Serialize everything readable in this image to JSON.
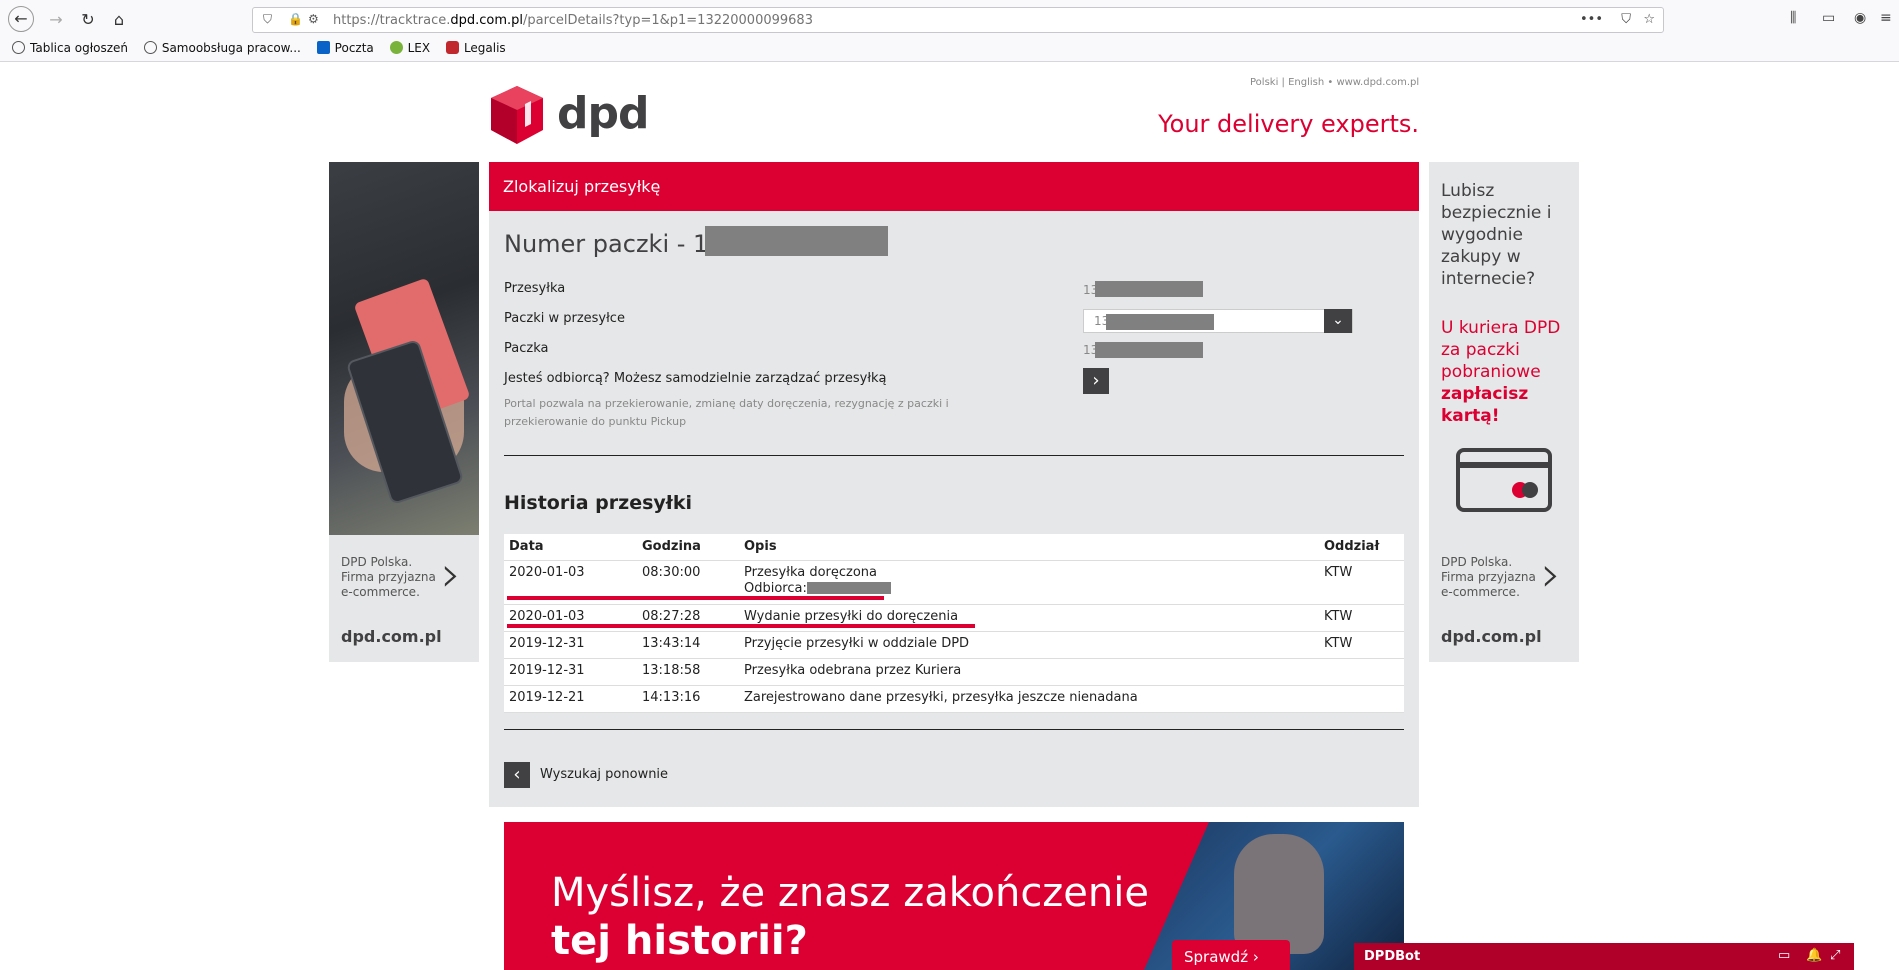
{
  "browser": {
    "url_prefix": "https://tracktrace.",
    "url_domain": "dpd.com.pl",
    "url_suffix": "/parcelDetails?typ=1&p1=13220000099683",
    "bookmarks": [
      "Tablica ogłoszeń",
      "Samoobsługa pracow...",
      "Poczta",
      "LEX",
      "Legalis"
    ]
  },
  "header": {
    "lang_links": "Polski | English • www.dpd.com.pl",
    "logo_text": "dpd",
    "slogan": "Your delivery experts."
  },
  "left_banner": {
    "note": "DPD Polska. Firma przyjazna e-commerce.",
    "site": "dpd.com.pl"
  },
  "right_banner": {
    "question": "Lubisz bezpiecznie i wygodnie zakupy w internecie?",
    "answer_lead": "U kuriera DPD za paczki pobraniowe",
    "answer_bold": "zapłacisz kartą!",
    "note": "DPD Polska. Firma przyjazna e-commerce.",
    "site": "dpd.com.pl"
  },
  "panel": {
    "heading": "Zlokalizuj przesyłkę",
    "parcel_title": "Numer paczki - 13",
    "fields": {
      "shipment_label": "Przesyłka",
      "shipment_value": "13",
      "packages_label": "Paczki w przesyłce",
      "packages_value": "13",
      "package_label": "Paczka",
      "package_value": "13",
      "manage_label": "Jesteś odbiorcą? Możesz samodzielnie zarządzać przesyłką"
    },
    "portal_note": "Portal pozwala na przekierowanie, zmianę daty doręczenia, rezygnację z paczki i przekierowanie do punktu Pickup",
    "history_title": "Historia przesyłki",
    "table": {
      "headers": [
        "Data",
        "Godzina",
        "Opis",
        "Oddział"
      ],
      "rows": [
        {
          "date": "2020-01-03",
          "time": "08:30:00",
          "desc": "Przesyłka doręczona",
          "desc2": "Odbiorca:",
          "branch": "KTW"
        },
        {
          "date": "2020-01-03",
          "time": "08:27:28",
          "desc": "Wydanie przesyłki do doręczenia",
          "desc2": "",
          "branch": "KTW"
        },
        {
          "date": "2019-12-31",
          "time": "13:43:14",
          "desc": "Przyjęcie przesyłki w oddziale DPD",
          "desc2": "",
          "branch": "KTW"
        },
        {
          "date": "2019-12-31",
          "time": "13:18:58",
          "desc": "Przesyłka odebrana przez Kuriera",
          "desc2": "",
          "branch": ""
        },
        {
          "date": "2019-12-21",
          "time": "14:13:16",
          "desc": "Zarejestrowano dane przesyłki, przesyłka jeszcze nienadana",
          "desc2": "",
          "branch": ""
        }
      ]
    },
    "search_again": "Wyszukaj ponownie"
  },
  "promo": {
    "line1": "Myślisz, że znasz zakończenie",
    "line2": "tej historii?",
    "button": "Sprawdź ›"
  },
  "dpdbot": {
    "title": "DPDBot"
  },
  "colors": {
    "brand_red": "#dc0032",
    "panel_grey": "#e6e7e8",
    "dark": "#414042"
  }
}
